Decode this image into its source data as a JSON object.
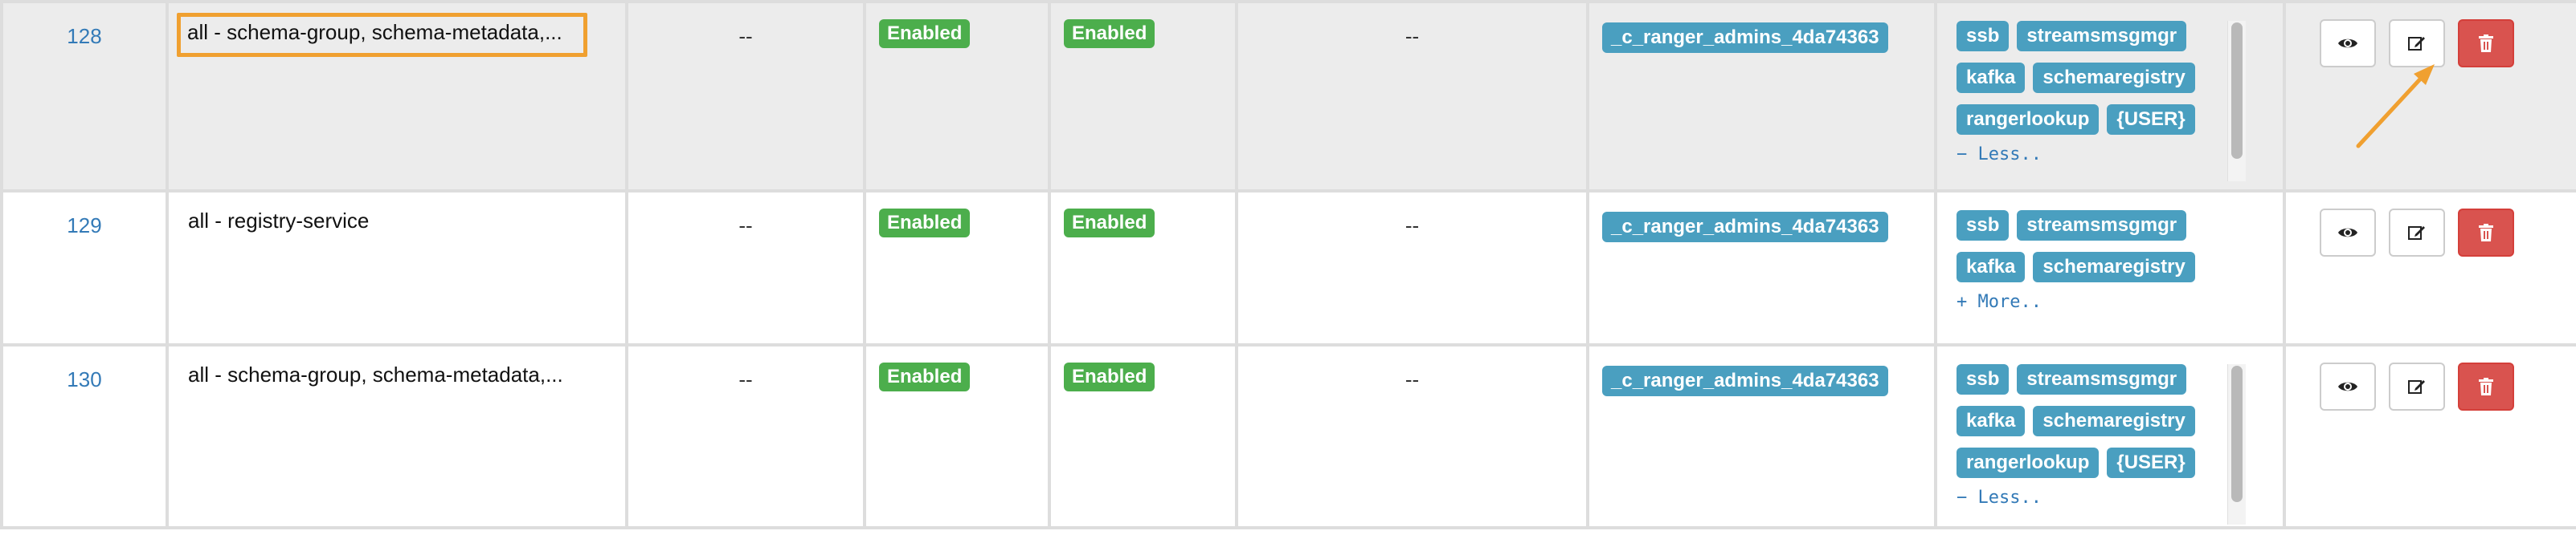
{
  "rows": [
    {
      "id": "128",
      "name": "all - schema-group, schema-metadata,...",
      "col3": "--",
      "status": "Enabled",
      "audit": "Enabled",
      "col6": "--",
      "group": "_c_ranger_admins_4da74363",
      "users": [
        "ssb",
        "streamsmsgmgr",
        "kafka",
        "schemaregistry",
        "rangerlookup",
        "{USER}"
      ],
      "toggle": "− Less.."
    },
    {
      "id": "129",
      "name": "all - registry-service",
      "col3": "--",
      "status": "Enabled",
      "audit": "Enabled",
      "col6": "--",
      "group": "_c_ranger_admins_4da74363",
      "users": [
        "ssb",
        "streamsmsgmgr",
        "kafka",
        "schemaregistry"
      ],
      "toggle": "+ More.."
    },
    {
      "id": "130",
      "name": "all - schema-group, schema-metadata,...",
      "col3": "--",
      "status": "Enabled",
      "audit": "Enabled",
      "col6": "--",
      "group": "_c_ranger_admins_4da74363",
      "users": [
        "ssb",
        "streamsmsgmgr",
        "kafka",
        "schemaregistry",
        "rangerlookup",
        "{USER}"
      ],
      "toggle": "− Less.."
    }
  ],
  "icons": {
    "view": "eye-icon",
    "edit": "edit-icon",
    "delete": "trash-icon"
  },
  "colors": {
    "success": "#4cae4c",
    "info": "#4a9fc0",
    "danger": "#d9534f",
    "highlight": "#f0a030",
    "link": "#337ab7"
  }
}
